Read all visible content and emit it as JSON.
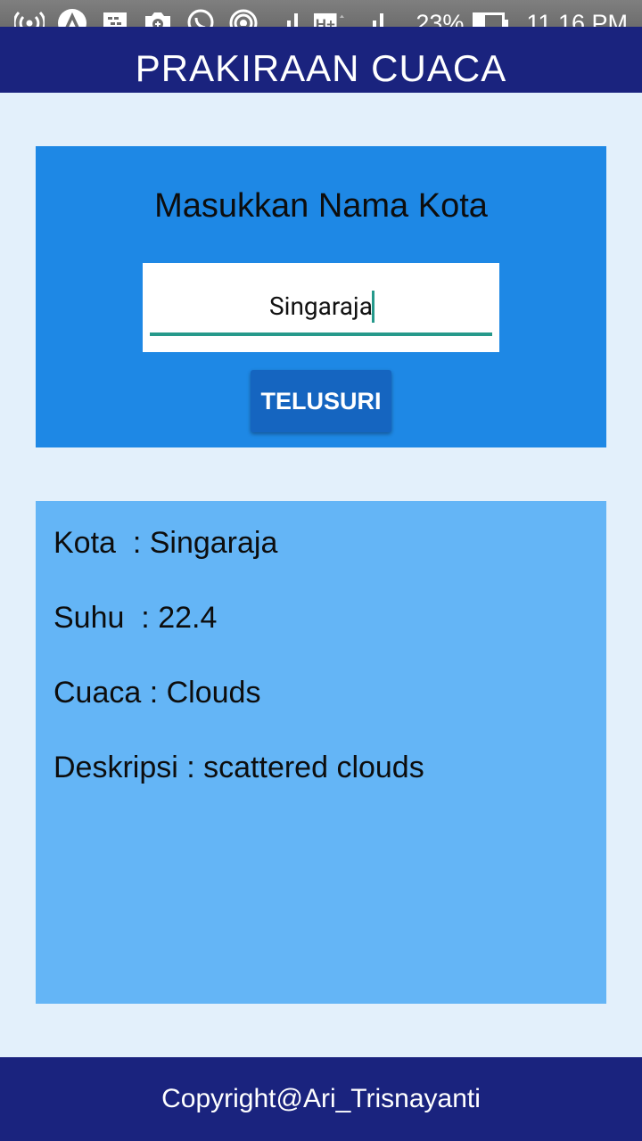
{
  "status_bar": {
    "battery_percent": "23%",
    "battery_level": 0.23,
    "time": "11.16 PM",
    "network": "H+",
    "icons": [
      "hotspot-icon",
      "app-icon",
      "bbm-icon",
      "camera-icon",
      "whatsapp-icon",
      "cast-icon",
      "signal-icon",
      "network-type-icon",
      "signal-icon",
      "battery-icon"
    ]
  },
  "app_bar": {
    "title": "PRAKIRAAN CUACA"
  },
  "search": {
    "heading": "Masukkan Nama Kota",
    "input_value": "Singaraja",
    "button_label": "TELUSURI"
  },
  "result": {
    "kota": "Kota  : Singaraja",
    "suhu": "Suhu  : 22.4",
    "cuaca": "Cuaca : Clouds",
    "deskripsi": "Deskripsi : scattered clouds"
  },
  "footer": {
    "copyright": "Copyright@Ari_Trisnayanti"
  },
  "colors": {
    "primary_dark": "#1a237e",
    "card_blue": "#1e88e5",
    "button_blue": "#1565c0",
    "result_blue": "#64b5f6",
    "background": "#e3f0fb",
    "accent_teal": "#26998b"
  }
}
